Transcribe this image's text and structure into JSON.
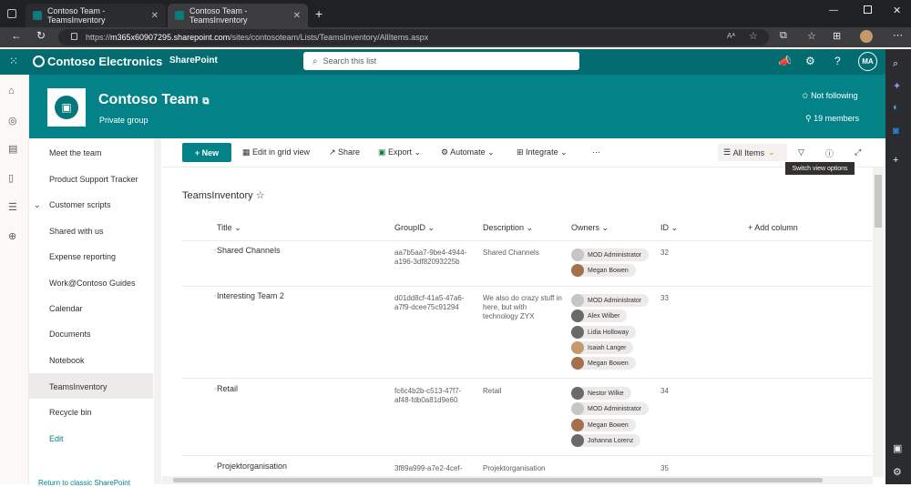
{
  "browser": {
    "tabs": [
      {
        "label": "Contoso Team - TeamsInventory"
      },
      {
        "label": "Contoso Team - TeamsInventory"
      }
    ],
    "url_prefix": "https://",
    "url_host": "m365x60907295.sharepoint.com",
    "url_path": "/sites/contosoteam/Lists/TeamsInventory/AllItems.aspx",
    "read_aloud": "Aᴬ"
  },
  "suite": {
    "brand": "Contoso Electronics",
    "app": "SharePoint",
    "search_placeholder": "Search this list",
    "avatar_initials": "MA"
  },
  "site": {
    "title": "Contoso Team",
    "subtitle": "Private group",
    "follow": "Not following",
    "members": "19 members"
  },
  "leftnav": {
    "items": [
      "Meet the team",
      "Product Support Tracker",
      "Customer scripts",
      "Shared with us",
      "Expense reporting",
      "Work@Contoso Guides",
      "Calendar",
      "Documents",
      "Notebook",
      "TeamsInventory",
      "Recycle bin",
      "Edit"
    ],
    "selected": "TeamsInventory",
    "footer": "Return to classic SharePoint"
  },
  "commands": {
    "new": "New",
    "grid": "Edit in grid view",
    "share": "Share",
    "export": "Export",
    "automate": "Automate",
    "integrate": "Integrate",
    "more": "···",
    "view": "All Items",
    "tooltip": "Switch view options"
  },
  "list": {
    "title": "TeamsInventory",
    "columns": {
      "title": "Title",
      "groupid": "GroupID",
      "description": "Description",
      "owners": "Owners",
      "id": "ID",
      "add": "Add column"
    },
    "rows": [
      {
        "title": "Shared Channels",
        "groupid1": "aa7b5aa7-9be4-4944-",
        "groupid2": "a196-3df82093225b",
        "desc1": "Shared Channels",
        "desc2": "",
        "desc3": "",
        "owners": [
          "MOD Administrator",
          "Megan Bowen"
        ],
        "id": "32"
      },
      {
        "title": "Interesting Team 2",
        "groupid1": "d01dd8cf-41a5-47a6-",
        "groupid2": "a7f9-dcee75c91294",
        "desc1": "We also do crazy stuff in",
        "desc2": "here, but with",
        "desc3": "technology ZYX",
        "owners": [
          "MOD Administrator",
          "Alex Wilber",
          "Lidia Holloway",
          "Isaiah Langer",
          "Megan Bowen"
        ],
        "id": "33"
      },
      {
        "title": "Retail",
        "groupid1": "fc6c4b2b-c513-47f7-",
        "groupid2": "af48-fdb0a81d9e60",
        "desc1": "Retail",
        "desc2": "",
        "desc3": "",
        "owners": [
          "Nestor Wilke",
          "MOD Administrator",
          "Megan Bowen",
          "Johanna Lorenz"
        ],
        "id": "34"
      },
      {
        "title": "Projektorganisation",
        "groupid1": "3f89a999-a7e2-4cef-",
        "groupid2": "",
        "desc1": "Projektorganisation",
        "desc2": "",
        "desc3": "",
        "owners": [],
        "id": "35"
      }
    ]
  },
  "icons": {
    "star": "☆",
    "star_filled": "✩",
    "person": "♂",
    "chevron": "⌄"
  }
}
